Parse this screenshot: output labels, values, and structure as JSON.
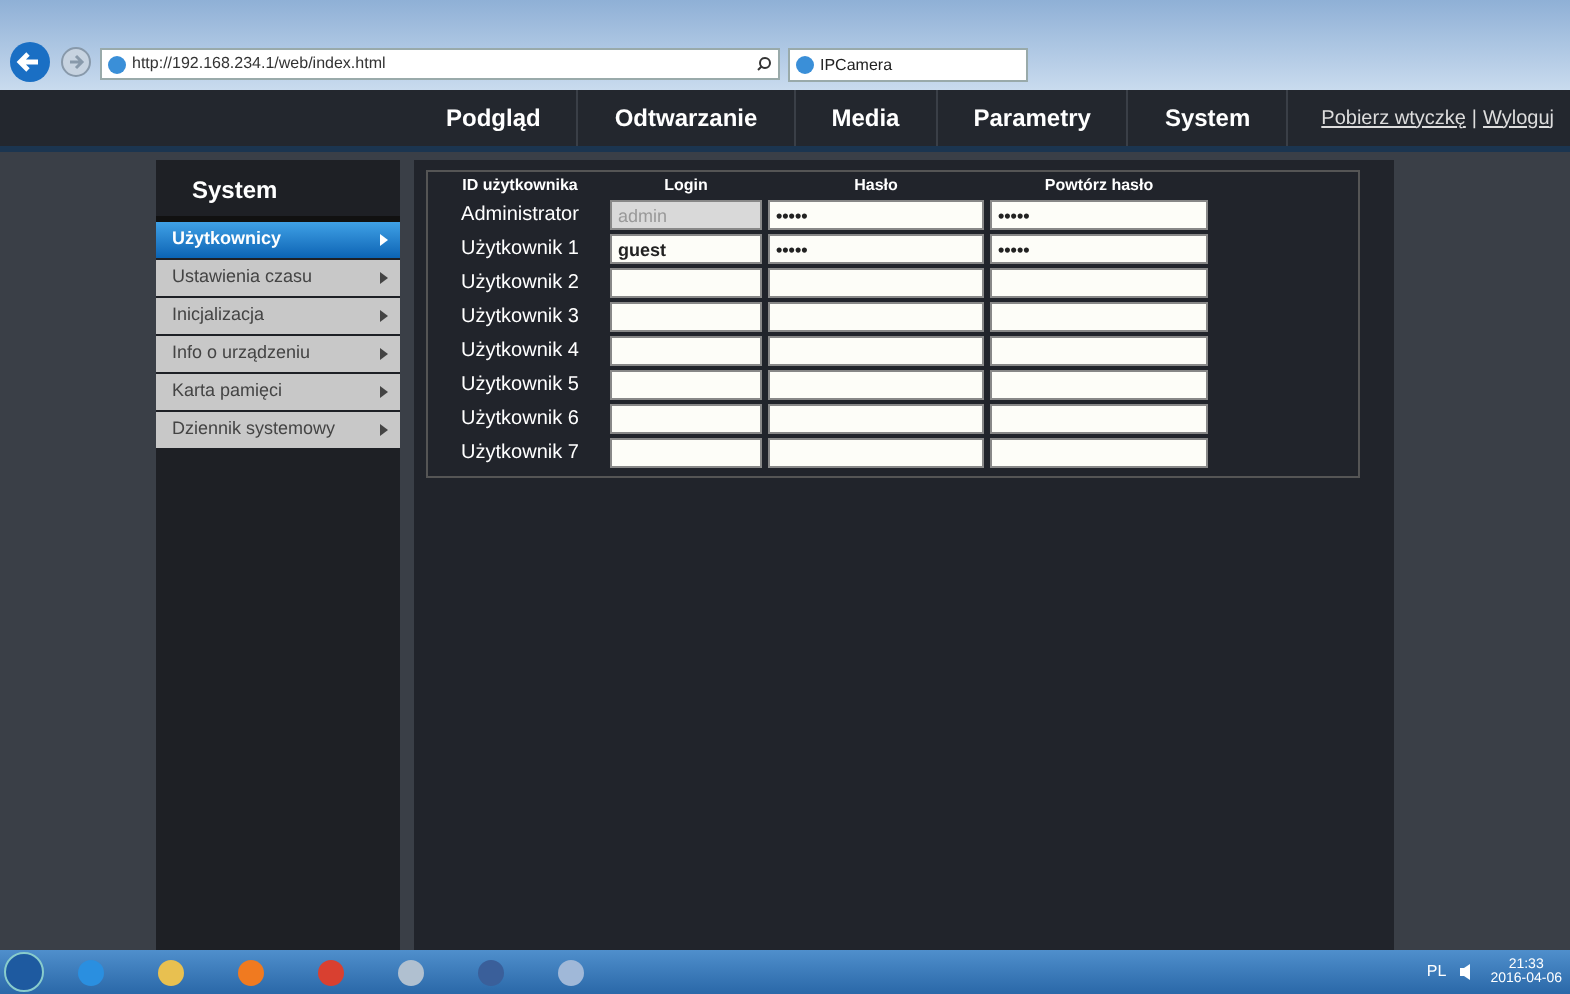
{
  "browser": {
    "url": "http://192.168.234.1/web/index.html",
    "tab_title": "IPCamera"
  },
  "nav": {
    "items": [
      "Podgląd",
      "Odtwarzanie",
      "Media",
      "Parametry",
      "System"
    ],
    "links": [
      "Pobierz wtyczkę",
      "|",
      "Wyloguj"
    ]
  },
  "sidebar": {
    "title": "System",
    "items": [
      {
        "label": "Użytkownicy",
        "selected": true
      },
      {
        "label": "Ustawienia czasu",
        "selected": false
      },
      {
        "label": "Inicjalizacja",
        "selected": false
      },
      {
        "label": "Info o urządzeniu",
        "selected": false
      },
      {
        "label": "Karta pamięci",
        "selected": false
      },
      {
        "label": "Dziennik systemowy",
        "selected": false
      }
    ]
  },
  "table": {
    "columns": [
      "ID użytkownika",
      "Login",
      "Hasło",
      "Powtórz hasło"
    ],
    "rows": [
      {
        "label": "Administrator",
        "login": "admin",
        "login_disabled": true,
        "password": "•••••",
        "repeat": "•••••"
      },
      {
        "label": "Użytkownik 1",
        "login": "guest",
        "login_disabled": false,
        "password": "•••••",
        "repeat": "•••••"
      },
      {
        "label": "Użytkownik 2",
        "login_disabled": false
      },
      {
        "label": "Użytkownik 3",
        "login_disabled": false
      },
      {
        "label": "Użytkownik 4",
        "login_disabled": false
      },
      {
        "label": "Użytkownik 5",
        "login_disabled": false
      },
      {
        "label": "Użytkownik 6",
        "login_disabled": false
      },
      {
        "label": "Użytkownik 7",
        "login_disabled": false
      }
    ]
  },
  "taskbar": {
    "language": "PL",
    "time": "21:33",
    "date": "2016-04-06"
  }
}
